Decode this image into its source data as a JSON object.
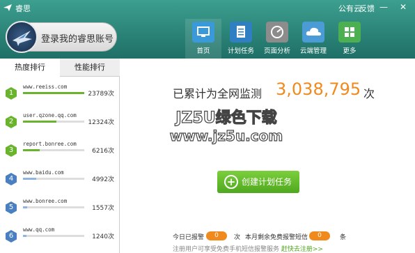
{
  "window": {
    "title": "睿思",
    "public_cloud": "公有云",
    "feedback": "反馈",
    "minimize": "—",
    "close": "✕"
  },
  "login": {
    "label": "登录我的睿思账号"
  },
  "nav": [
    {
      "label": "首页",
      "icon": "monitor-icon",
      "color": "#3a9ad9"
    },
    {
      "label": "计划任务",
      "icon": "clipboard-icon",
      "color": "#2f7fc2"
    },
    {
      "label": "页面分析",
      "icon": "gauge-icon",
      "color": "#8c8c8c"
    },
    {
      "label": "云端管理",
      "icon": "cloud-icon",
      "color": "#4a9bd6"
    },
    {
      "label": "更多",
      "icon": "grid-icon",
      "color": "#4caf50"
    }
  ],
  "tabs": {
    "hot": "热度排行",
    "perf": "性能排行"
  },
  "ranking": [
    {
      "rank": "1",
      "url": "www.reeiss.com",
      "count": "23789次",
      "fill": 1.0,
      "badge": "#6ab42d",
      "bar": "#6ab42d"
    },
    {
      "rank": "2",
      "url": "user.qzone.qq.com",
      "count": "12324次",
      "fill": 0.55,
      "badge": "#6ab42d",
      "bar": "#6ab42d"
    },
    {
      "rank": "3",
      "url": "report.bonree.com",
      "count": "6216次",
      "fill": 0.27,
      "badge": "#6ab42d",
      "bar": "#6ab42d"
    },
    {
      "rank": "4",
      "url": "www.baidu.com",
      "count": "4992次",
      "fill": 0.22,
      "badge": "#4a7fc1",
      "bar": "#8db5e0"
    },
    {
      "rank": "5",
      "url": "www.bonree.com",
      "count": "1557次",
      "fill": 0.07,
      "badge": "#4a7fc1",
      "bar": "#8db5e0"
    },
    {
      "rank": "6",
      "url": "www.qq.com",
      "count": "1240次",
      "fill": 0.06,
      "badge": "#4a7fc1",
      "bar": "#8db5e0"
    }
  ],
  "monitor": {
    "label": "已累计为全网监测",
    "count": "3,038,795",
    "unit": "次"
  },
  "create": {
    "label": "创建计划任务"
  },
  "footer": {
    "today_label": "今日已报警",
    "today_count": "0",
    "times": "次",
    "sms_label": "本月剩余免费报警短信",
    "sms_count": "0",
    "sms_unit": "条",
    "register_text": "注册用户可享受免费手机短信报警服务",
    "register_link": "赶快去注册>>"
  },
  "watermark": {
    "line1": "JZ5U绿色下载",
    "line2": "www.jz5u.com"
  }
}
